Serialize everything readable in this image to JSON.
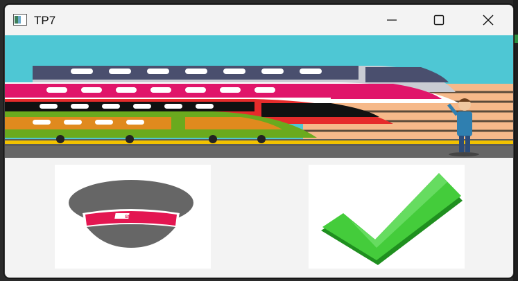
{
  "window": {
    "title": "TP7"
  },
  "icons": {
    "app": "app-window-icon",
    "minimize": "minimize-icon",
    "maximize": "maximize-icon",
    "close": "close-icon",
    "controller_cap": "controller-cap-icon",
    "checkmark": "checkmark-icon"
  },
  "banner": {
    "logo_text": "SNCF"
  },
  "colors": {
    "sky": "#4ec7d4",
    "cap_red": "#e31651",
    "check_green": "#2ebd2e"
  }
}
